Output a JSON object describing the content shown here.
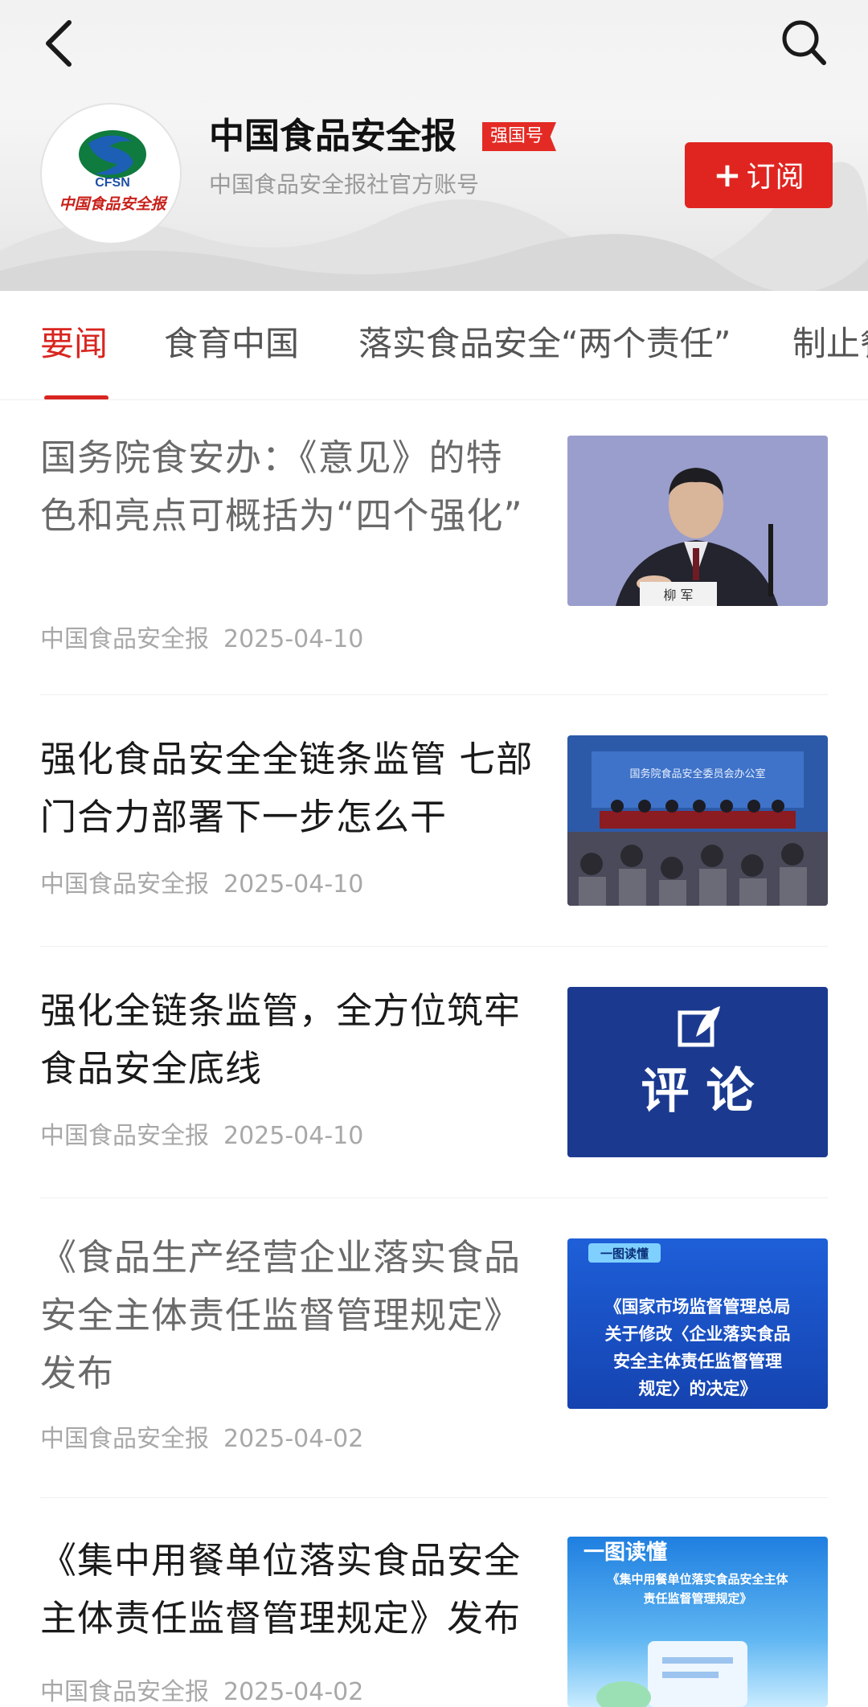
{
  "header": {
    "account_name": "中国食品安全报",
    "badge": "强国号",
    "description": "中国食品安全报社官方账号",
    "subscribe_label": "订阅",
    "logo_text": "CFSN",
    "logo_caption": "中国食品安全报",
    "back_icon": "chevron-left-icon",
    "search_icon": "search-icon"
  },
  "tabs": [
    {
      "label": "要闻",
      "active": true
    },
    {
      "label": "食育中国",
      "active": false
    },
    {
      "label": "落实食品安全“两个责任”",
      "active": false
    },
    {
      "label": "制止餐",
      "active": false
    }
  ],
  "articles": [
    {
      "title": "国务院食安办：《意见》的特色和亮点可概括为“四个强化”",
      "source": "中国食品安全报",
      "date": "2025-04-10",
      "thumb_caption": "柳 军"
    },
    {
      "title": "强化食品安全全链条监管 七部门合力部署下一步怎么干",
      "source": "中国食品安全报",
      "date": "2025-04-10",
      "thumb_caption": "国务院食品安全委员会办公室"
    },
    {
      "title": "强化全链条监管，全方位筑牢食品安全底线",
      "source": "中国食品安全报",
      "date": "2025-04-10",
      "thumb_caption": "评 论"
    },
    {
      "title": "《食品生产经营企业落实食品安全主体责任监督管理规定》发布",
      "source": "中国食品安全报",
      "date": "2025-04-02",
      "thumb_tag": "一图读懂",
      "thumb_lines": [
        "《国家市场监督管理总局",
        "关于修改〈企业落实食品",
        "安全主体责任监督管理",
        "规定〉的决定》"
      ]
    },
    {
      "title": "《集中用餐单位落实食品安全主体责任监督管理规定》发布",
      "source": "中国食品安全报",
      "date": "2025-04-02",
      "thumb_tag": "一图读懂",
      "thumb_lines": [
        "《集中用餐单位落实食品安全主体",
        "责任监督管理规定》"
      ]
    }
  ],
  "colors": {
    "accent": "#d9251f",
    "badge": "#e42a24",
    "thumb_blue": "#1b3a8f"
  }
}
